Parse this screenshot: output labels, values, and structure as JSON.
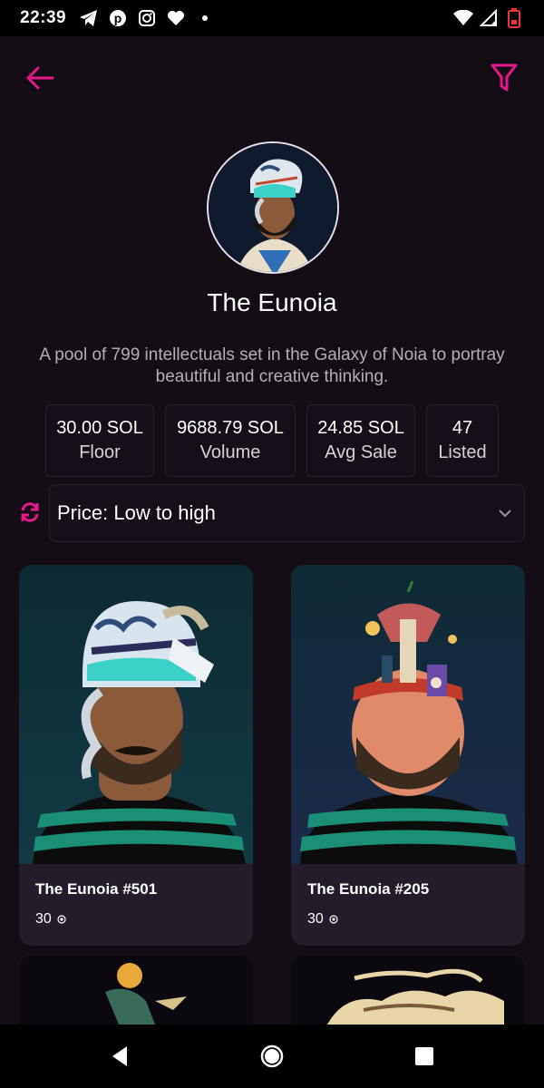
{
  "status_bar": {
    "time": "22:39",
    "left_icons": [
      "telegram-icon",
      "pinterest-icon",
      "instagram-icon",
      "heart-icon",
      "dot-icon"
    ],
    "right_icons": [
      "wifi-icon",
      "cellular-icon",
      "battery-icon"
    ]
  },
  "colors": {
    "accent": "#e6198a",
    "background": "#140d16",
    "card_bg": "#241c2a",
    "border": "#2a2230"
  },
  "header": {
    "back_icon": "arrow-left-icon",
    "filter_icon": "filter-icon",
    "collection_name": "The Eunoia",
    "description": "A pool of 799 intellectuals set in the Galaxy of Noia to portray beautiful and creative thinking."
  },
  "stats": [
    {
      "value": "30.00 SOL",
      "label": "Floor"
    },
    {
      "value": "9688.79 SOL",
      "label": "Volume"
    },
    {
      "value": "24.85 SOL",
      "label": "Avg Sale"
    },
    {
      "value": "47",
      "label": "Listed"
    }
  ],
  "sort": {
    "refresh_icon": "refresh-icon",
    "selected": "Price: Low to high",
    "chevron_icon": "chevron-down-icon"
  },
  "items": [
    {
      "name": "The Eunoia #501",
      "price": "30",
      "currency_icon": "sol-icon"
    },
    {
      "name": "The Eunoia #205",
      "price": "30",
      "currency_icon": "sol-icon"
    }
  ],
  "nav_bar": {
    "icons": [
      "nav-back-icon",
      "nav-home-icon",
      "nav-recents-icon"
    ]
  }
}
